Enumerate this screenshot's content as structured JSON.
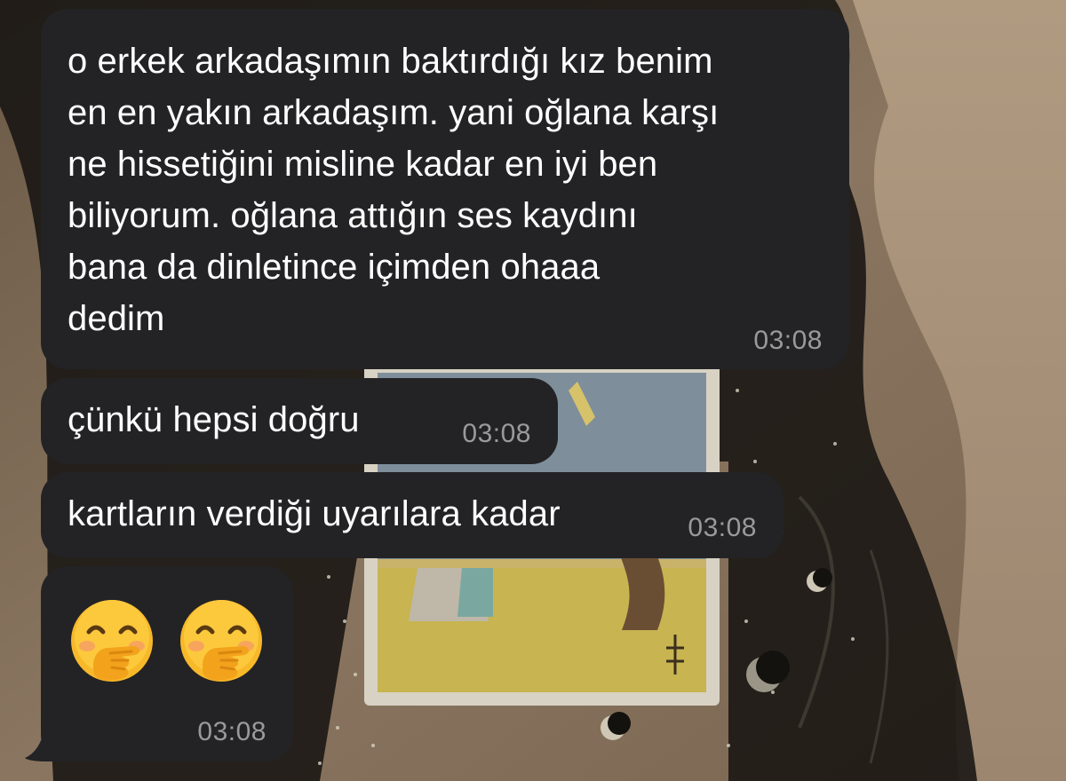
{
  "messages": [
    {
      "text": "o erkek arkadaşımın baktırdığı kız benim\nen en yakın arkadaşım. yani oğlana karşı\nne hissetiğini misline kadar en iyi ben\nbiliyorum. oğlana attığın ses kaydını\nbana da dinletince içimden ohaaa\ndedim",
      "time": "03:08"
    },
    {
      "text": "çünkü hepsi doğru",
      "time": "03:08"
    },
    {
      "text": "kartların verdiği uyarılara kadar",
      "time": "03:08"
    },
    {
      "emojis": [
        "face-with-hand-over-mouth",
        "face-with-hand-over-mouth"
      ],
      "time": "03:08"
    }
  ],
  "colors": {
    "bubble": "#232325",
    "text": "#ffffff",
    "timestamp": "#9a9a9c"
  }
}
